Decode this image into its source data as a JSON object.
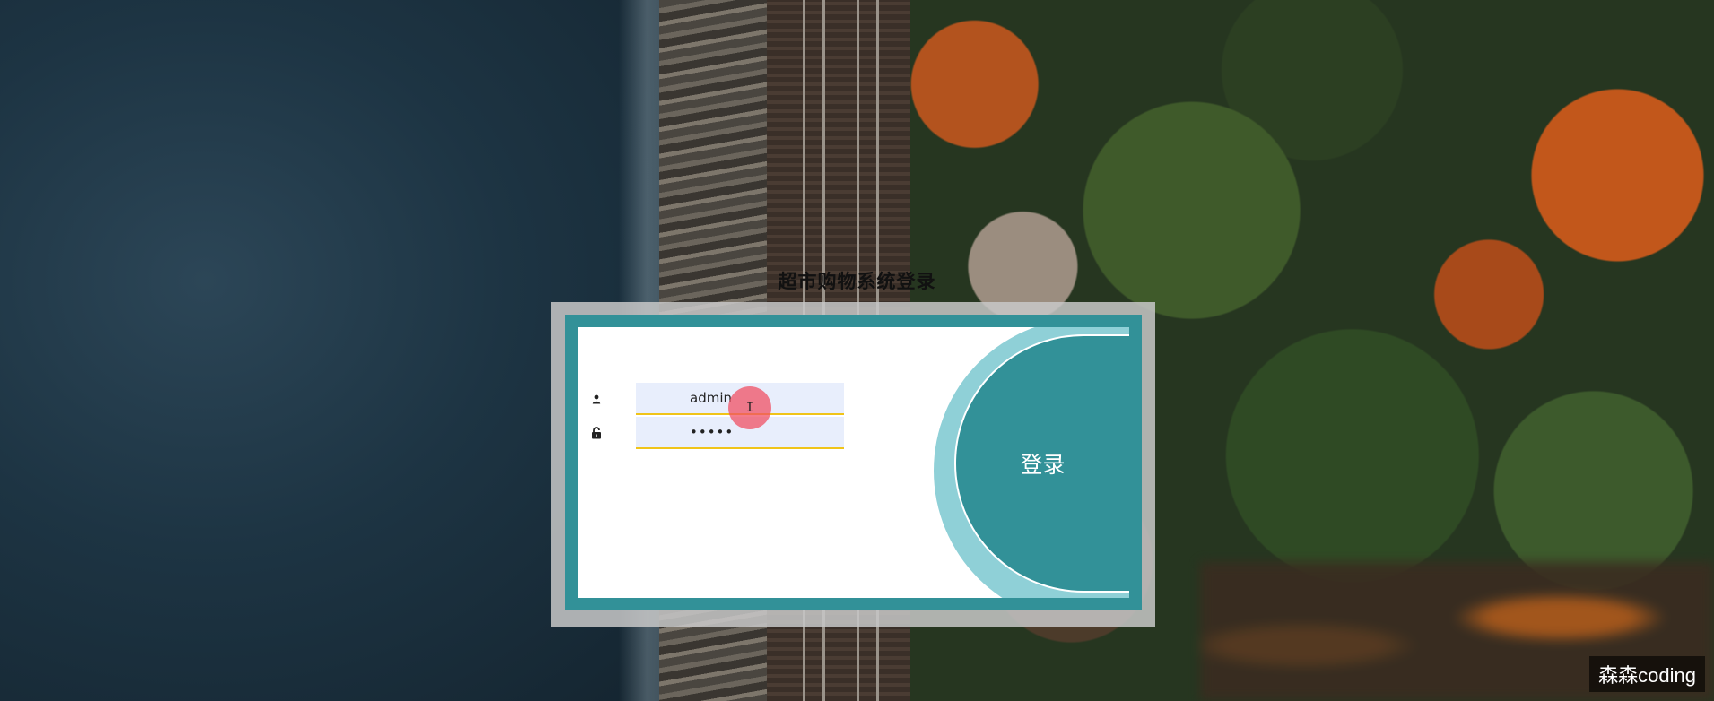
{
  "page": {
    "title": "超市购物系统登录"
  },
  "login_form": {
    "username_value": "admin",
    "password_value": "•••••",
    "submit_label": "登录",
    "username_icon": "user-icon",
    "password_icon": "lock-icon"
  },
  "pointer": {
    "cursor_glyph": "I"
  },
  "watermark": {
    "text": "森森coding"
  },
  "colors": {
    "accent": "#329198",
    "accent_light": "#8fd0d7",
    "input_underline": "#f0c419",
    "input_bg": "#e8eefc"
  }
}
